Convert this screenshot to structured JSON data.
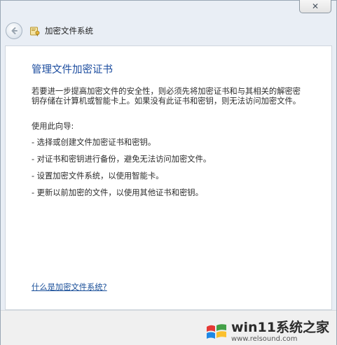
{
  "window": {
    "close_label": "✕",
    "nav_title": "加密文件系统"
  },
  "content": {
    "title": "管理文件加密证书",
    "description": "若要进一步提高加密文件的安全性，则必须先将加密证书和与其相关的解密密钥存储在计算机或智能卡上。如果没有此证书和密钥，则无法访问加密文件。",
    "guide_label": "使用此向导:",
    "items": [
      "- 选择或创建文件加密证书和密钥。",
      "- 对证书和密钥进行备份，避免无法访问加密文件。",
      "- 设置加密文件系统，以使用智能卡。",
      "- 更新以前加密的文件，以使用其他证书和密钥。"
    ],
    "help_link": "什么是加密文件系统?"
  },
  "watermark": {
    "title": "win11系统之家",
    "url": "www.relsound.com",
    "colors": [
      "#e53935",
      "#fbc02d",
      "#1e88e5",
      "#43a047"
    ]
  }
}
